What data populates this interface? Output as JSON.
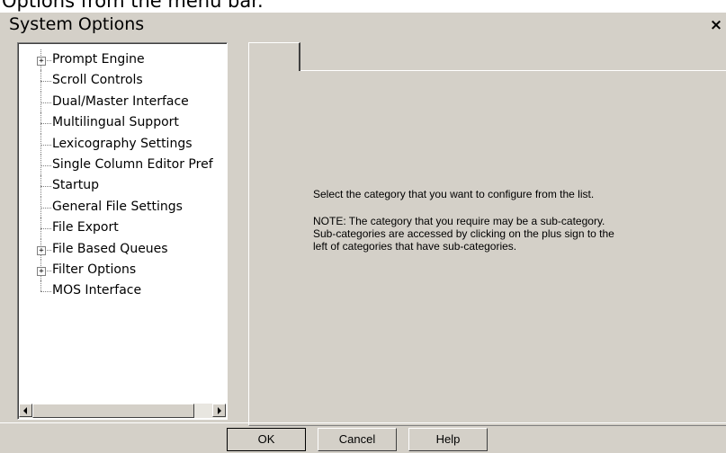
{
  "top_strip": {
    "text": "Options from the menu bar."
  },
  "window": {
    "title": "System Options",
    "close_glyph": "×"
  },
  "tree": {
    "items": [
      {
        "label": "Prompt Engine",
        "expandable": true
      },
      {
        "label": "Scroll Controls",
        "expandable": false
      },
      {
        "label": "Dual/Master Interface",
        "expandable": false
      },
      {
        "label": "Multilingual Support",
        "expandable": false
      },
      {
        "label": "Lexicography Settings",
        "expandable": false
      },
      {
        "label": "Single Column Editor Pref",
        "expandable": false
      },
      {
        "label": "Startup",
        "expandable": false
      },
      {
        "label": "General File Settings",
        "expandable": false
      },
      {
        "label": "File Export",
        "expandable": false
      },
      {
        "label": "File Based Queues",
        "expandable": true
      },
      {
        "label": "Filter Options",
        "expandable": true
      },
      {
        "label": "MOS Interface",
        "expandable": false
      }
    ],
    "expander_glyph": "+"
  },
  "panel": {
    "tab_label": "",
    "message_lines": [
      "Select the category that you want to configure from the list.",
      "NOTE: The category that you require may be a sub-category.",
      "Sub-categories are accessed by clicking on the plus sign to the",
      "left of categories that have sub-categories."
    ]
  },
  "buttons": {
    "ok": "OK",
    "cancel": "Cancel",
    "help": "Help"
  },
  "icons": {
    "scroll_left": "triangle-left-icon",
    "scroll_right": "triangle-right-icon",
    "close": "close-icon"
  }
}
